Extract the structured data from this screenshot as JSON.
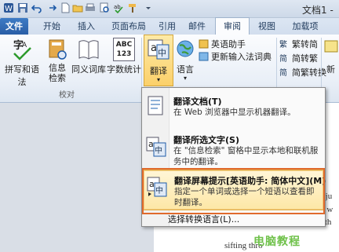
{
  "window": {
    "title": "文档1 -"
  },
  "tabs": [
    "文件",
    "开始",
    "插入",
    "页面布局",
    "引用",
    "邮件",
    "审阅",
    "视图",
    "加载项"
  ],
  "ribbon": {
    "proofing": {
      "buttons": [
        "拼写和语法",
        "信息\n检索",
        "同义词库",
        "字数统计"
      ],
      "group_label": "校对",
      "abc_text": "ABC\n123"
    },
    "translate_label": "翻译",
    "language_label": "语言",
    "language_items": [
      "英语助手",
      "更新输入法词典"
    ],
    "chinese_conversion": [
      "繁转简",
      "简转繁",
      "简繁转换"
    ],
    "new_label": "新"
  },
  "menu": {
    "items": [
      {
        "title": "翻译文档(T)",
        "desc": "在 Web 浏览器中显示机器翻译。"
      },
      {
        "title": "翻译所选文字(S)",
        "desc": "在 \"信息检索\" 窗格中显示本地和联机服务中的翻译。"
      },
      {
        "title": "翻译屏幕提示[英语助手: 简体中文](M)",
        "desc": "指定一个单词或选择一个短语以查看即时翻译。"
      },
      {
        "title": "选择转换语言(L)..."
      }
    ]
  },
  "document": {
    "lines": [
      "ters ju",
      "ter w",
      "t th",
      "sifting thro"
    ]
  },
  "watermark": "电脑教程",
  "colors": {
    "file_tab": "#2a5ea6",
    "highlight_border": "#e06a2c",
    "menu_highlight": "#fde7a6"
  }
}
